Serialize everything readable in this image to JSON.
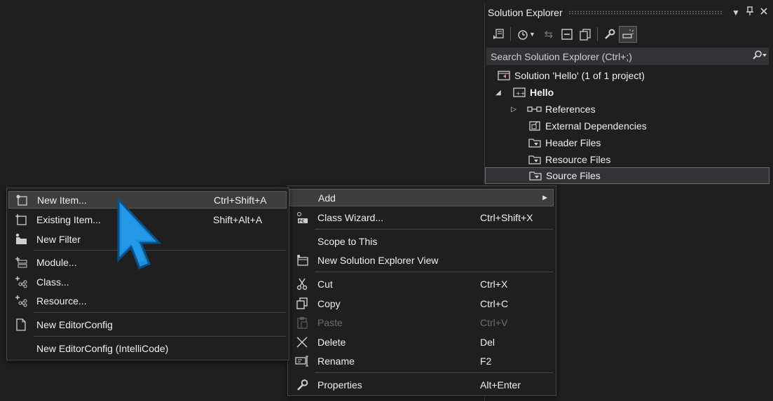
{
  "solution_explorer": {
    "title": "Solution Explorer",
    "title_buttons": [
      "dropdown-icon",
      "pin-icon",
      "close-icon"
    ],
    "toolbar_icons": [
      "switch-views-icon",
      "pending-changes-icon",
      "sync-icon",
      "collapse-all-icon",
      "show-all-files-icon",
      "properties-icon",
      "preview-selected-icon"
    ],
    "search_placeholder": "Search Solution Explorer (Ctrl+;)",
    "tree": {
      "solution": "Solution 'Hello' (1 of 1 project)",
      "project": "Hello",
      "references": "References",
      "external_dependencies": "External Dependencies",
      "header_files": "Header Files",
      "resource_files": "Resource Files",
      "source_files": "Source Files"
    },
    "selected_item": "Source Files"
  },
  "context_menu": {
    "items": [
      {
        "label": "Add",
        "submenu": true,
        "highlighted": true
      },
      {
        "label": "Class Wizard...",
        "shortcut": "Ctrl+Shift+X"
      },
      {
        "label": "Scope to This"
      },
      {
        "label": "New Solution Explorer View"
      },
      {
        "label": "Cut",
        "shortcut": "Ctrl+X"
      },
      {
        "label": "Copy",
        "shortcut": "Ctrl+C"
      },
      {
        "label": "Paste",
        "shortcut": "Ctrl+V",
        "disabled": true
      },
      {
        "label": "Delete",
        "shortcut": "Del"
      },
      {
        "label": "Rename",
        "shortcut": "F2"
      },
      {
        "label": "Properties",
        "shortcut": "Alt+Enter"
      }
    ]
  },
  "add_submenu": {
    "items": [
      {
        "label": "New Item...",
        "shortcut": "Ctrl+Shift+A",
        "highlighted": true
      },
      {
        "label": "Existing Item...",
        "shortcut": "Shift+Alt+A"
      },
      {
        "label": "New Filter"
      },
      {
        "label": "Module..."
      },
      {
        "label": "Class..."
      },
      {
        "label": "Resource..."
      },
      {
        "label": "New EditorConfig"
      },
      {
        "label": "New EditorConfig (IntelliCode)"
      }
    ]
  },
  "colors": {
    "background": "#1f1f1f",
    "cursor": "#1a8fe0",
    "highlight": "#3d3d3d"
  }
}
